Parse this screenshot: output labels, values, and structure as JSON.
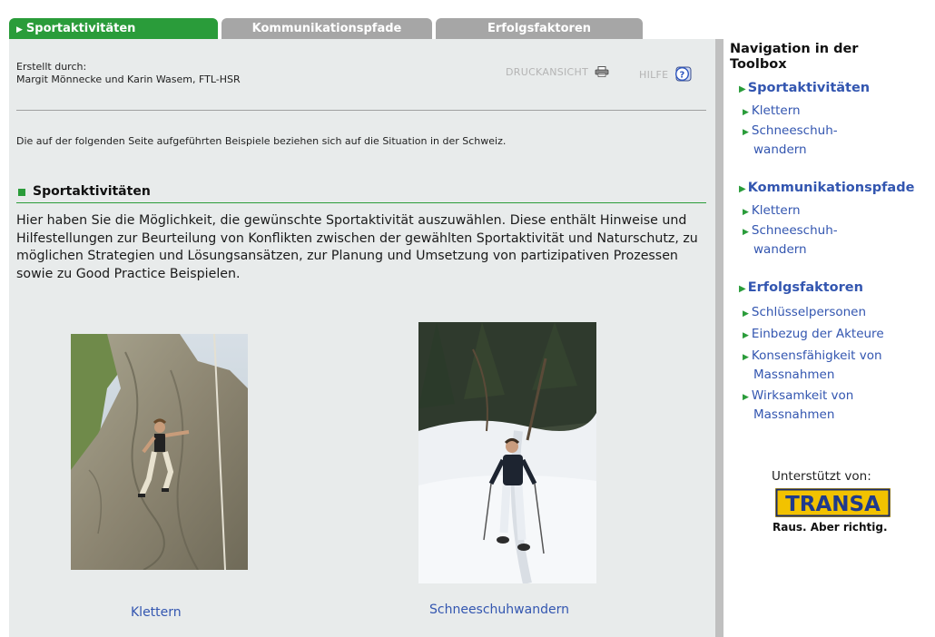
{
  "tabs": [
    {
      "label": "Sportaktivitäten",
      "active": true
    },
    {
      "label": "Kommunikationspfade",
      "active": false
    },
    {
      "label": "Erfolgsfaktoren",
      "active": false
    }
  ],
  "credit": {
    "line1": "Erstellt durch:",
    "line2": "Margit Mönnecke und Karin Wasem, FTL-HSR"
  },
  "tools": {
    "print_label": "DRUCKANSICHT",
    "help_label": "HILFE",
    "print_icon": "printer-icon",
    "help_icon": "help-icon"
  },
  "note": "Die auf der folgenden Seite aufgeführten Beispiele beziehen sich auf die Situation in der Schweiz.",
  "section": {
    "title": "Sportaktivitäten",
    "intro": "Hier haben Sie die Möglichkeit, die gewünschte Sportaktivität auszuwählen. Diese enthält Hinweise und Hilfestellungen zur Beurteilung von Konflikten zwischen der gewählten Sportaktivität und Naturschutz, zu möglichen Strategien und Lösungsansätzen, zur Planung und Umsetzung von partizipativen Prozessen sowie zu Good Practice Beispielen."
  },
  "photos": [
    {
      "caption": "Klettern"
    },
    {
      "caption": "Schneeschuhwandern"
    }
  ],
  "nav": {
    "title_line1": "Navigation in der",
    "title_line2": "Toolbox",
    "groups": [
      {
        "label": "Sportaktivitäten",
        "items": [
          {
            "line1": "Klettern",
            "line2": ""
          },
          {
            "line1": "Schneeschuh-",
            "line2": "wandern"
          }
        ]
      },
      {
        "label": "Kommunikationspfade",
        "items": [
          {
            "line1": "Klettern",
            "line2": ""
          },
          {
            "line1": "Schneeschuh-",
            "line2": "wandern"
          }
        ]
      },
      {
        "label": "Erfolgsfaktoren",
        "items": [
          {
            "line1": "Schlüsselpersonen",
            "line2": ""
          },
          {
            "line1": "Einbezug der Akteure",
            "line2": ""
          },
          {
            "line1": "Konsensfähigkeit von",
            "line2": "Massnahmen"
          },
          {
            "line1": "Wirksamkeit von",
            "line2": "Massnahmen"
          }
        ]
      }
    ]
  },
  "support": {
    "label": "Unterstützt von:",
    "logo_text": "TRANSA",
    "slogan": "Raus. Aber richtig."
  },
  "colors": {
    "accent_green": "#2a9c3a",
    "link_blue": "#3356b0",
    "panel_bg": "#e8ebeb",
    "tab_inactive": "#a6a6a6"
  }
}
